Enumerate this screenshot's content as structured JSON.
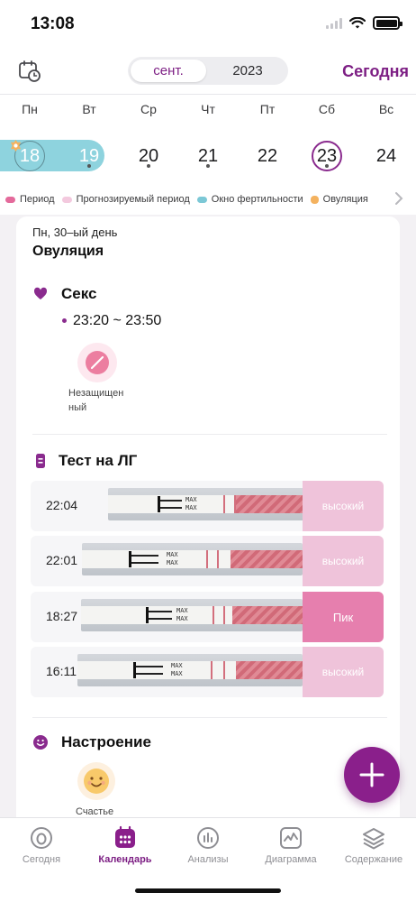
{
  "status_bar": {
    "time": "13:08"
  },
  "header": {
    "month_tab": "сент.",
    "year_tab": "2023",
    "today_button": "Сегодня",
    "accent_color": "#7d1f84"
  },
  "week": {
    "weekdays": [
      "Пн",
      "Вт",
      "Ср",
      "Чт",
      "Пт",
      "Сб",
      "Вс"
    ],
    "days": [
      "18",
      "19",
      "20",
      "21",
      "22",
      "23",
      "24"
    ],
    "fertile_days": [
      "18",
      "19"
    ],
    "selected_day": "23"
  },
  "legend": {
    "items": [
      {
        "label": "Период",
        "color": "#e46a9b"
      },
      {
        "label": "Прогнозируемый период",
        "color": "#f3c9de"
      },
      {
        "label": "Окно фертильности",
        "color": "#7cc8d6"
      },
      {
        "label": "Овуляция",
        "color": "#f4b25f"
      }
    ]
  },
  "detail": {
    "day_title": "Пн, 30–ый день",
    "day_subtitle": "Овуляция",
    "sex": {
      "title": "Секс",
      "time": "23:20 ~ 23:50",
      "protection_label": "Незащищен ный"
    },
    "lh_test": {
      "title": "Тест на ЛГ",
      "entries": [
        {
          "time": "22:04",
          "result": "высокий",
          "level": "high"
        },
        {
          "time": "22:01",
          "result": "высокий",
          "level": "high"
        },
        {
          "time": "18:27",
          "result": "Пик",
          "level": "peak"
        },
        {
          "time": "16:11",
          "result": "высокий",
          "level": "high"
        }
      ],
      "strip_text": "MAX"
    },
    "mood": {
      "title": "Настроение",
      "value": "Счастье"
    }
  },
  "tabbar": {
    "items": [
      {
        "label": "Сегодня",
        "icon": "today-icon"
      },
      {
        "label": "Календарь",
        "icon": "calendar-icon"
      },
      {
        "label": "Анализы",
        "icon": "analysis-icon"
      },
      {
        "label": "Диаграмма",
        "icon": "chart-icon"
      },
      {
        "label": "Содержание",
        "icon": "content-icon"
      }
    ],
    "active": "Календарь"
  }
}
